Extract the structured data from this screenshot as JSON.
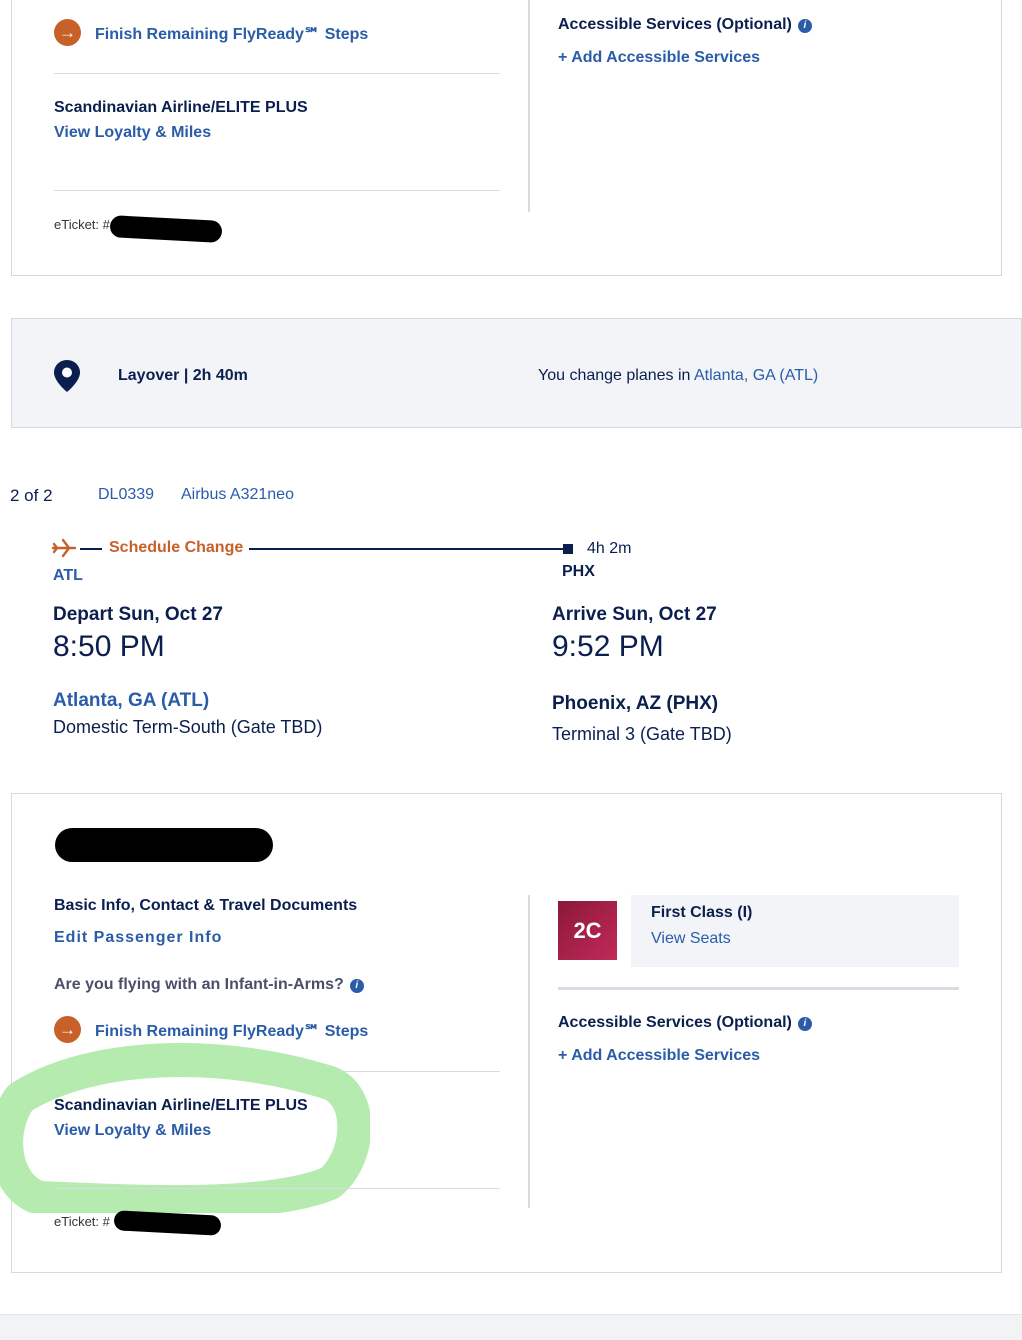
{
  "segment1": {
    "flyready_label": "Finish Remaining FlyReady℠ Steps",
    "loyalty_program": "Scandinavian Airline/ELITE PLUS",
    "loyalty_link": "View Loyalty & Miles",
    "eticket_label": "eTicket: #",
    "accessible_title": "Accessible Services (Optional)",
    "accessible_link": "+ Add Accessible Services"
  },
  "layover": {
    "title": "Layover | 2h 40m",
    "change_text": "You change planes in ",
    "change_city": "Atlanta, GA (ATL)"
  },
  "flight2": {
    "counter": "2 of 2",
    "flight_no": "DL0339",
    "aircraft": "Airbus A321neo",
    "schedule_change": "Schedule Change",
    "duration": "4h 2m",
    "origin_code": "ATL",
    "dest_code": "PHX",
    "depart_label": "Depart Sun, Oct 27",
    "depart_time": "8:50 PM",
    "depart_city": "Atlanta, GA (ATL)",
    "depart_terminal": "Domestic Term-South (Gate TBD)",
    "arrive_label": "Arrive Sun, Oct 27",
    "arrive_time": "9:52 PM",
    "arrive_city": "Phoenix, AZ (PHX)",
    "arrive_terminal": "Terminal 3 (Gate TBD)"
  },
  "passenger": {
    "basic_info": "Basic Info, Contact & Travel Documents",
    "edit_link": "Edit Passenger Info",
    "infant_question": "Are you flying with an Infant-in-Arms?",
    "flyready_label": "Finish Remaining FlyReady℠ Steps",
    "loyalty_program": "Scandinavian Airline/ELITE PLUS",
    "loyalty_link": "View Loyalty & Miles",
    "eticket_label": "eTicket: #",
    "seat": "2C",
    "cabin": "First Class (I)",
    "view_seats": "View Seats",
    "accessible_title": "Accessible Services (Optional)",
    "accessible_link": "+ Add Accessible Services"
  },
  "colors": {
    "navy": "#0b1f4f",
    "link": "#2a5ca8",
    "orange": "#c8602a",
    "seat_badge": "#b01e4e",
    "highlight": "#b6ebb0"
  },
  "icons": [
    "arrow-right-icon",
    "info-icon",
    "location-pin-icon",
    "plane-icon"
  ]
}
